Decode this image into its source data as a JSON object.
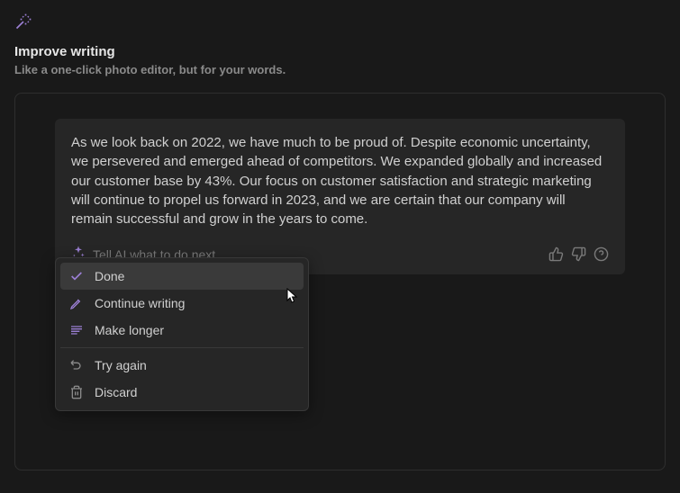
{
  "header": {
    "title": "Improve writing",
    "subtitle": "Like a one-click photo editor, but for your words."
  },
  "ai_response": {
    "text": "As we look back on 2022, we have much to be proud of. Despite economic uncertainty, we persevered and emerged ahead of competitors. We expanded globally and increased our customer base by 43%. Our focus on customer satisfaction and strategic marketing will continue to propel us forward in 2023, and we are certain that our company will remain successful and grow in the years to come."
  },
  "prompt": {
    "placeholder": "Tell AI what to do next..."
  },
  "menu": {
    "done": "Done",
    "continue": "Continue writing",
    "longer": "Make longer",
    "retry": "Try again",
    "discard": "Discard"
  }
}
